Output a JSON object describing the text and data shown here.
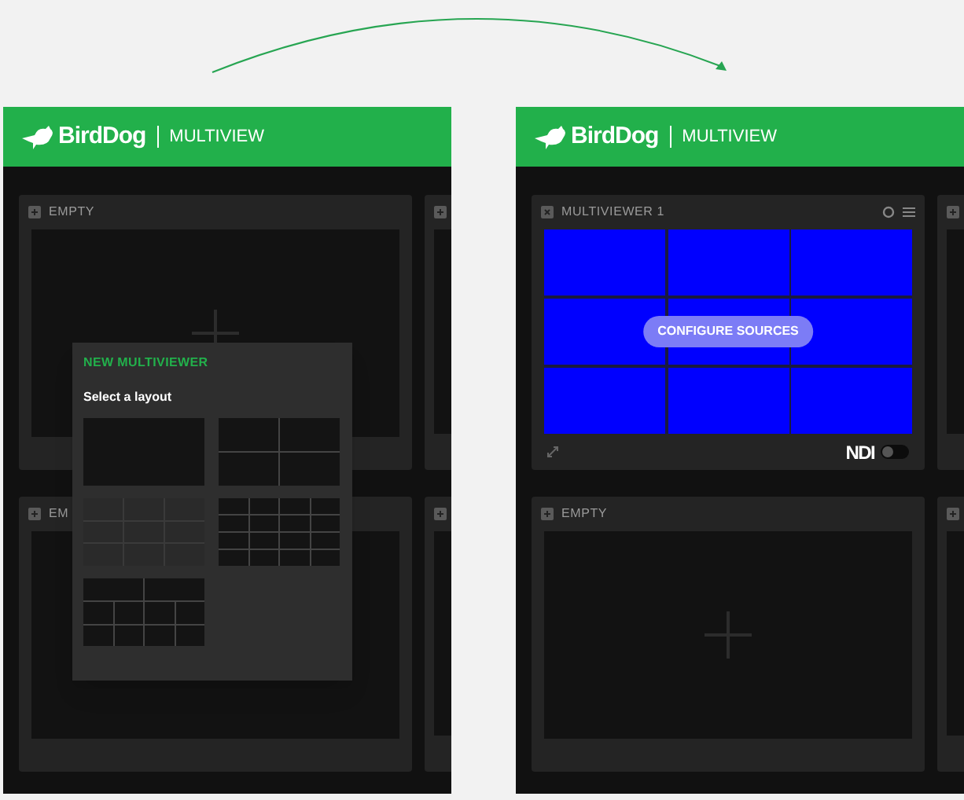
{
  "screens": [
    {
      "header": {
        "brand": "BirdDog",
        "product": "MULTIVIEW"
      },
      "tiles": [
        {
          "kind": "empty",
          "title": "EMPTY"
        },
        {
          "kind": "edge"
        },
        {
          "kind": "empty",
          "title": "EM"
        },
        {
          "kind": "edge"
        }
      ],
      "dialog": {
        "title": "NEW MULTIVIEWER",
        "prompt": "Select a layout",
        "layouts": [
          {
            "kind": "single",
            "selected": false
          },
          {
            "kind": "quad",
            "selected": false
          },
          {
            "kind": "grid-3x3",
            "selected": true
          },
          {
            "kind": "grid-4x4",
            "selected": false
          },
          {
            "kind": "two-plus-eight",
            "selected": false
          }
        ]
      }
    },
    {
      "header": {
        "brand": "BirdDog",
        "product": "MULTIVIEW"
      },
      "tiles": [
        {
          "kind": "multiviewer",
          "title": "MULTIVIEWER 1",
          "action": "CONFIGURE SOURCES",
          "badge": "NDI",
          "ndi_on": false
        },
        {
          "kind": "edge"
        },
        {
          "kind": "empty",
          "title": "EMPTY"
        },
        {
          "kind": "edge"
        }
      ]
    }
  ]
}
